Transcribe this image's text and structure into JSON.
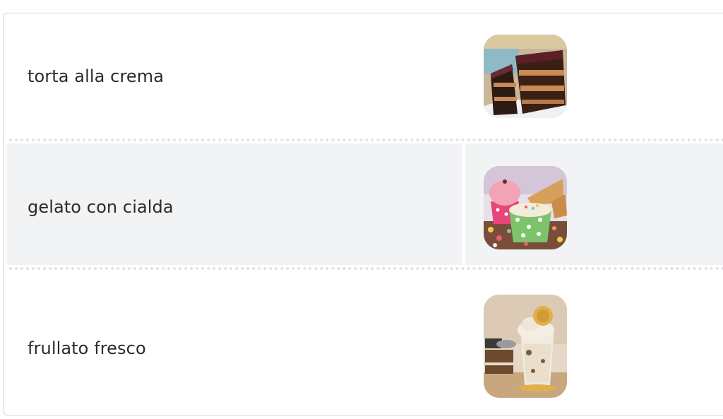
{
  "items": [
    {
      "label": "torta alla crema",
      "image_icon": "layered-chocolate-cake-image"
    },
    {
      "label": "gelato con cialda",
      "image_icon": "ice-cream-cups-with-cones-image"
    },
    {
      "label": "frullato fresco",
      "image_icon": "milkshake-glass-image"
    }
  ],
  "colors": {
    "row_alt_background": "#f1f3f5",
    "border": "#cfd6df",
    "separator": "#dfe3e8",
    "text": "#2b2b2b"
  }
}
